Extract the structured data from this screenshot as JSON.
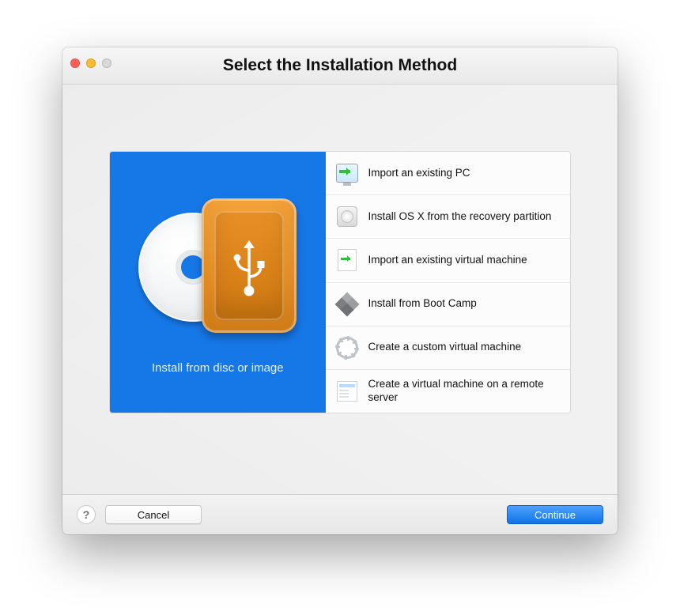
{
  "window": {
    "title": "Select the Installation Method"
  },
  "hero": {
    "label": "Install from disc or image"
  },
  "options": [
    {
      "label": "Import an existing PC"
    },
    {
      "label": "Install OS X from the recovery partition"
    },
    {
      "label": "Import an existing virtual machine"
    },
    {
      "label": "Install from Boot Camp"
    },
    {
      "label": "Create a custom virtual machine"
    },
    {
      "label": "Create a virtual machine on a remote server"
    }
  ],
  "footer": {
    "help": "?",
    "cancel": "Cancel",
    "continue": "Continue"
  }
}
